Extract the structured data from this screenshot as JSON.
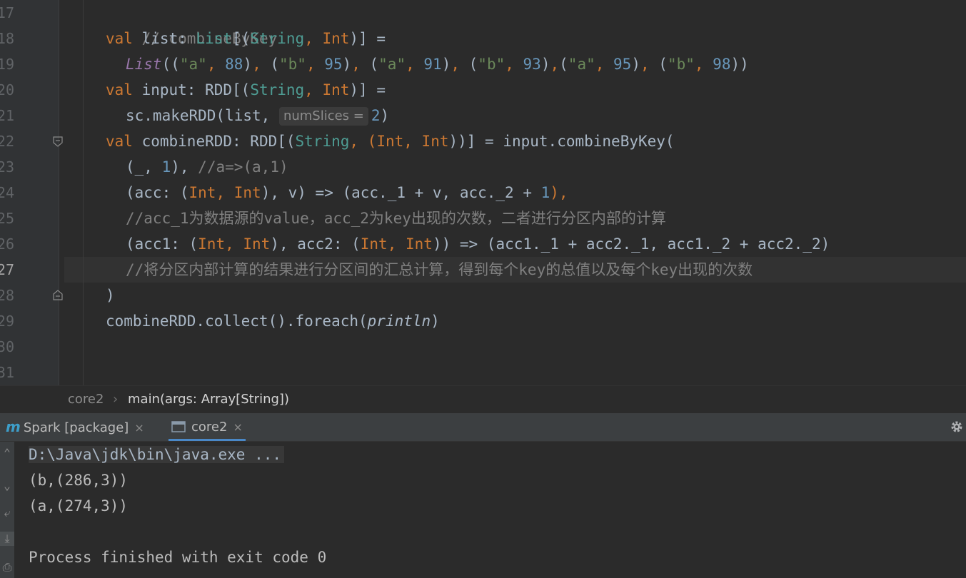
{
  "line_numbers": [
    "17",
    "18",
    "19",
    "20",
    "21",
    "22",
    "23",
    "24",
    "25",
    "26",
    "27",
    "28",
    "29",
    "30",
    "31"
  ],
  "code": {
    "l17": {
      "comment": "// combineByKey"
    },
    "l18": {
      "kw": "val",
      "name": " list: ",
      "type": "List",
      "p1": "[(",
      "t1": "String",
      "c1": ", ",
      "t2": "Int",
      "p2": ")] ="
    },
    "l19": {
      "fn": "List",
      "p_open": "((",
      "pairs": [
        {
          "k": "\"a\"",
          "v": "88"
        },
        {
          "k": "\"b\"",
          "v": "95"
        },
        {
          "k": "\"a\"",
          "v": "91"
        },
        {
          "k": "\"b\"",
          "v": "93"
        },
        {
          "k": "\"a\"",
          "v": "95"
        },
        {
          "k": "\"b\"",
          "v": "98"
        }
      ]
    },
    "l20": {
      "kw": "val",
      "name": " input: RDD[(",
      "t1": "String",
      "c1": ", ",
      "t2": "Int",
      "p2": ")] ="
    },
    "l21": {
      "pre": "sc.makeRDD(list, ",
      "hint": "numSlices =",
      "arg": "2",
      "post": ")"
    },
    "l22": {
      "kw": "val",
      "name": " combineRDD: RDD[(",
      "t1": "String",
      "c1": ", (",
      "t2": "Int",
      "c2": ", ",
      "t3": "Int",
      "post": "))] = input.combineByKey("
    },
    "l23": {
      "pre": "(_, ",
      "num": "1",
      "mid": "), ",
      "comment": "//a=>(a,1)"
    },
    "l24": {
      "a": "(acc: (",
      "t1": "Int",
      "c1": ", ",
      "t2": "Int",
      "b": "), v) => (acc._1 + v, acc._2 + ",
      "num": "1",
      "c": "),",
      "cm": ""
    },
    "l25": {
      "comment": "//acc_1为数据源的value，acc_2为key出现的次数，二者进行分区内部的计算"
    },
    "l26": {
      "a": "(acc1: (",
      "t1": "Int",
      "c1": ", ",
      "t2": "Int",
      "b": "), acc2: (",
      "t3": "Int",
      "c2": ", ",
      "t4": "Int",
      "c": ")) => (acc1._1 + acc2._1, acc1._2 + acc2._2)"
    },
    "l27": {
      "comment": "//将分区内部计算的结果进行分区间的汇总计算，得到每个key的总值以及每个key出现的次数"
    },
    "l28": {
      "text": ")"
    },
    "l29": {
      "pre": "combineRDD.collect().foreach(",
      "fn": "println",
      "post": ")"
    }
  },
  "breadcrumb": {
    "file": "core2",
    "sep": "›",
    "method": "main(args: Array[String])"
  },
  "tool_tabs": [
    {
      "label": "Spark [package]",
      "icon": "maven-icon",
      "close": "×"
    },
    {
      "label": "core2",
      "icon": "console-icon",
      "close": "×"
    }
  ],
  "console": {
    "lines": [
      "D:\\Java\\jdk\\bin\\java.exe ...",
      "(b,(286,3))",
      "(a,(274,3))",
      "",
      "Process finished with exit code 0"
    ]
  },
  "icons": {
    "settings": "gear-icon",
    "fold": "fold-icon"
  },
  "colors": {
    "background": "#2b2b2b",
    "keyword": "#cc7832",
    "type": "#4e9c93",
    "string": "#6a8759",
    "number": "#6897bb",
    "comment": "#808080"
  }
}
